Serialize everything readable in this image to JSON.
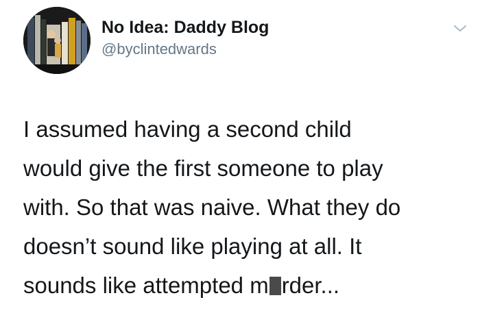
{
  "tweet": {
    "author": {
      "display_name": "No Idea: Daddy Blog",
      "handle": "@byclintedwards",
      "avatar_icon": "profile-photo"
    },
    "menu_icon": "chevron-down-icon",
    "text_lines": [
      "I assumed having a second child",
      "would give the first someone to play",
      "with. So that was naive. What they do",
      "doesn’t sound like playing at all. It"
    ],
    "last_line": {
      "before_censor": "sounds like attempted m",
      "after_censor": "rder..."
    }
  },
  "colors": {
    "text": "#14171a",
    "secondary_text": "#657786",
    "background": "#ffffff",
    "censor": "#4a4a4a"
  }
}
